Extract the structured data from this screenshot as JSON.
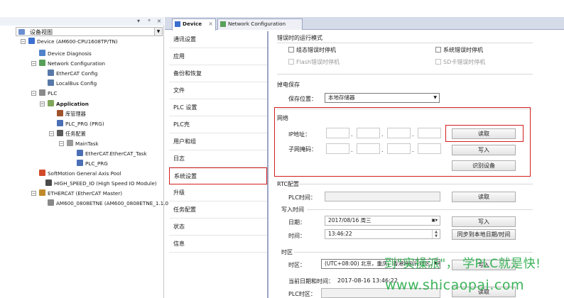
{
  "tree": {
    "pin_icon": "pin-icon",
    "combo_value": "设备视图",
    "nodes": [
      {
        "name": "device",
        "label": "Device (AM600-CPU1608TP/TN)",
        "bold": false,
        "icon": "device-icon",
        "color": "#3b6fd0",
        "expand": "−"
      },
      {
        "name": "device-diagnosis",
        "label": "Device Diagnosis",
        "bold": false,
        "icon": "diagnosis-icon",
        "color": "#4f82c9",
        "expand": ""
      },
      {
        "name": "network-configuration",
        "label": "Network Configuration",
        "bold": false,
        "icon": "network-icon",
        "color": "#58a05a",
        "expand": "−"
      },
      {
        "name": "ethercat-config",
        "label": "EtherCAT Config",
        "bold": false,
        "icon": "config-icon",
        "color": "#5778a8",
        "expand": ""
      },
      {
        "name": "localbus-config",
        "label": "LocalBus Config",
        "bold": false,
        "icon": "config-icon",
        "color": "#5778a8",
        "expand": ""
      },
      {
        "name": "plc",
        "label": "PLC",
        "bold": false,
        "icon": "plc-icon",
        "color": "#8a8a8a",
        "expand": "−"
      },
      {
        "name": "application",
        "label": "Application",
        "bold": true,
        "icon": "application-icon",
        "color": "#7fa65a",
        "expand": "−"
      },
      {
        "name": "library-manager",
        "label": "库管理器",
        "bold": false,
        "icon": "library-icon",
        "color": "#a0522d",
        "expand": ""
      },
      {
        "name": "plc-prg",
        "label": "PLC_PRG (PRG)",
        "bold": false,
        "icon": "program-icon",
        "color": "#4a6fb5",
        "expand": ""
      },
      {
        "name": "task-config",
        "label": "任务配置",
        "bold": false,
        "icon": "task-config-icon",
        "color": "#5a5a5a",
        "expand": "−"
      },
      {
        "name": "maintask",
        "label": "MainTask",
        "bold": false,
        "icon": "task-icon",
        "color": "#9a9a9a",
        "expand": "−"
      },
      {
        "name": "ethercat-task",
        "label": "EtherCAT.EtherCAT_Task",
        "bold": false,
        "icon": "program-icon",
        "color": "#4a6fb5",
        "expand": ""
      },
      {
        "name": "plc-prg-call",
        "label": "PLC_PRG",
        "bold": false,
        "icon": "program-icon",
        "color": "#4a6fb5",
        "expand": ""
      },
      {
        "name": "softmotion-pool",
        "label": "SoftMotion General Axis Pool",
        "bold": false,
        "icon": "axis-pool-icon",
        "color": "#d24a2a",
        "expand": ""
      },
      {
        "name": "high-speed-io",
        "label": "HIGH_SPEED_IO (High Speed IO Module)",
        "bold": false,
        "icon": "io-module-icon",
        "color": "#4a4a4a",
        "expand": ""
      },
      {
        "name": "ethercat-master",
        "label": "ETHERCAT (EtherCAT Master)",
        "bold": false,
        "icon": "ethercat-icon",
        "color": "#c08a2a",
        "expand": "−"
      },
      {
        "name": "am600-0808etne",
        "label": "AM600_0808ETNE (AM600_0808ETNE_1.1.0",
        "bold": false,
        "icon": "slave-module-icon",
        "color": "#888888",
        "expand": ""
      }
    ]
  },
  "tabs": [
    {
      "label": "Device",
      "icon": "device-icon",
      "active": true
    },
    {
      "label": "Network Configuration",
      "icon": "network-icon",
      "active": false
    }
  ],
  "nav": [
    {
      "label": "通讯设置"
    },
    {
      "label": "应用"
    },
    {
      "label": "备份和恢复"
    },
    {
      "label": "文件"
    },
    {
      "label": "PLC 设置"
    },
    {
      "label": "PLC壳"
    },
    {
      "label": "用户和组"
    },
    {
      "label": "日志"
    },
    {
      "label": "系统设置",
      "selected": true
    },
    {
      "label": "升级"
    },
    {
      "label": "任务配置"
    },
    {
      "label": "状态"
    },
    {
      "label": "信息"
    }
  ],
  "error_section": {
    "title": "错误时的运行模式",
    "options": [
      {
        "label": "组态错误时停机",
        "checked": false,
        "disabled": false
      },
      {
        "label": "系统错误时停机",
        "checked": false,
        "disabled": false
      },
      {
        "label": "Flash错误时停机",
        "checked": false,
        "disabled": true
      },
      {
        "label": "SD卡错误时停机",
        "checked": false,
        "disabled": true
      }
    ]
  },
  "power_section": {
    "title": "掉电保存",
    "save_location_label": "保存位置：",
    "save_location_value": "本地存储器"
  },
  "network_section": {
    "title": "网络",
    "ip_label": "IP地址：",
    "mask_label": "子网掩码：",
    "ip_values": [
      "",
      "",
      "",
      ""
    ],
    "mask_values": [
      "",
      "",
      "",
      ""
    ],
    "read_button": "读取",
    "write_button": "写入",
    "identify_button": "识别设备"
  },
  "rtc_section": {
    "title": "RTC配置",
    "plc_time_label": "PLC时间：",
    "plc_time_value": "",
    "read_button": "读取",
    "write_group_title": "写入时间",
    "date_label": "日期：",
    "date_value": "2017/08/16 周三",
    "time_label": "时间：",
    "time_value": "13:46:22",
    "write_button": "写入",
    "sync_button": "同步到本地日期/时间"
  },
  "timezone_section": {
    "title": "时区",
    "zone_label": "时区：",
    "zone_value": "(UTC+08:00) 北京，重庆，香港特别行政区，乌鲁木齐",
    "write_button": "写入",
    "current_label": "当前日期和时间：",
    "current_value": "2017-08-16 13:46:22",
    "plc_zone_label": "PLC时区：",
    "read_button": "读取"
  },
  "watermark": {
    "line1": "到\"实操派\"，  学PLC就是快!",
    "line2": "www.shicaopai.com"
  }
}
